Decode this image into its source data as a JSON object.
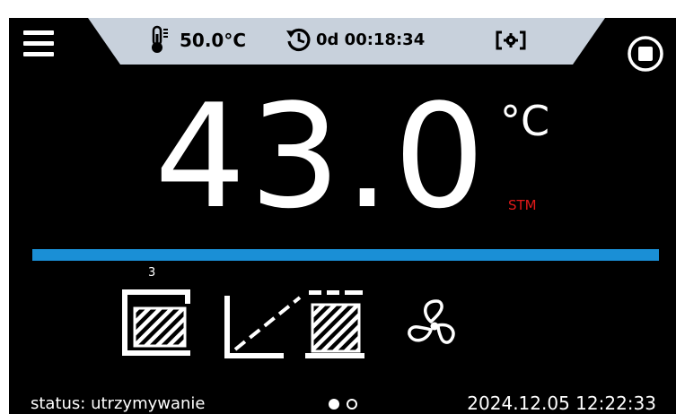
{
  "header": {
    "set_temperature": "50.0°C",
    "timer": "0d 00:18:34"
  },
  "main": {
    "temperature": "43.0",
    "unit": "°C",
    "mode": "STM",
    "program_index": "3"
  },
  "footer": {
    "status": "status: utrzymywanie",
    "datetime": "2024.12.05  12:22:33",
    "page_count": 2,
    "active_page": 1
  },
  "colors": {
    "background": "#000000",
    "topbar": "#c8d1dc",
    "progress_bar": "#1a8fd6",
    "mode_text": "#e11919"
  },
  "icons": [
    "menu-icon",
    "thermometer-icon",
    "timer-icon",
    "camera-settings-icon",
    "stop-icon",
    "chamber-icon",
    "ramp-icon",
    "fan-icon"
  ]
}
